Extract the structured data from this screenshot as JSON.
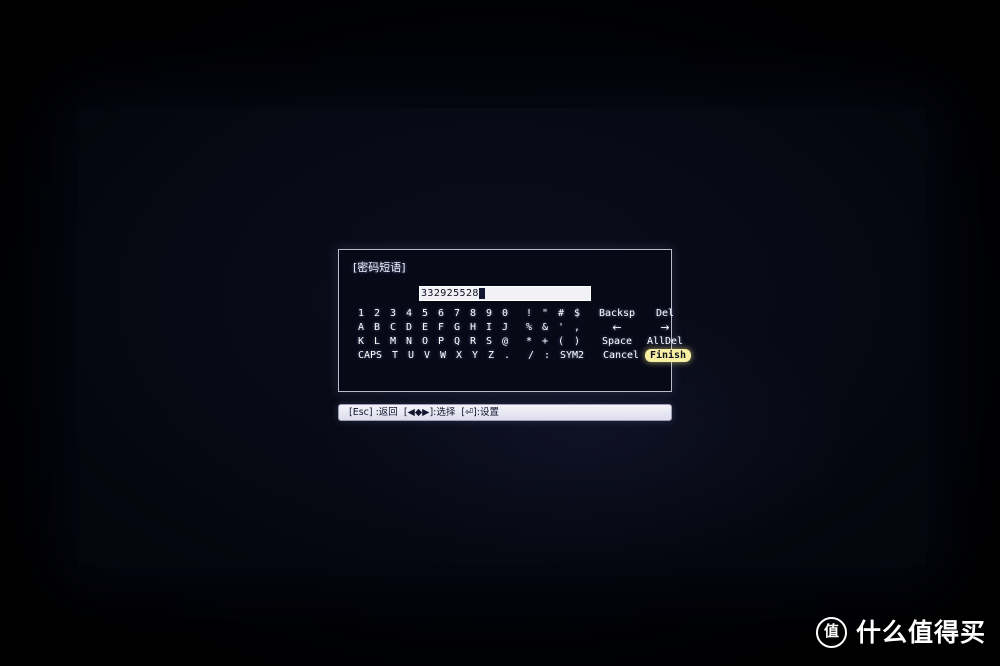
{
  "watermark": {
    "badge": "值",
    "text": "什么值得买"
  },
  "dialog": {
    "title": "[密码短语]",
    "input": {
      "value": "332925528",
      "placeholder": "",
      "cursor": "block"
    },
    "keyboard": {
      "rows": [
        {
          "keys": [
            "1",
            "2",
            "3",
            "4",
            "5",
            "6",
            "7",
            "8",
            "9",
            "0"
          ],
          "symbols": [
            "!",
            "\"",
            "#",
            "$"
          ],
          "actions": [
            "Backsp",
            "Del"
          ]
        },
        {
          "keys": [
            "A",
            "B",
            "C",
            "D",
            "E",
            "F",
            "G",
            "H",
            "I",
            "J"
          ],
          "symbols": [
            "%",
            "&",
            "'",
            ","
          ],
          "actions": [
            "←",
            "→"
          ]
        },
        {
          "keys": [
            "K",
            "L",
            "M",
            "N",
            "O",
            "P",
            "Q",
            "R",
            "S",
            "@"
          ],
          "symbols": [
            "*",
            "+",
            "(",
            ")"
          ],
          "actions": [
            "Space",
            "AllDel"
          ]
        },
        {
          "keys": [
            "CAPS",
            "T",
            "U",
            "V",
            "W",
            "X",
            "Y",
            "Z",
            "."
          ],
          "symbols": [
            "/",
            ":",
            "SYM2"
          ],
          "actions": [
            "Cancel",
            "Finish"
          ]
        }
      ],
      "selected_action": "Finish"
    }
  },
  "status_bar": {
    "text": "[Esc] :返回  [◀◆▶]:选择  [⏎]:设置"
  },
  "colors": {
    "osd_background": "#070917",
    "osd_border": "#b9bccd",
    "osd_text": "#ffffff",
    "highlight": "#f7f0a2",
    "highlight_text": "#10121f",
    "input_background": "#f2f2f6",
    "input_text": "#0b0d20",
    "status_background": "#f4f3fa",
    "status_text": "#11142c",
    "screen_background": "#0b0d1c",
    "room_background": "#000000"
  }
}
